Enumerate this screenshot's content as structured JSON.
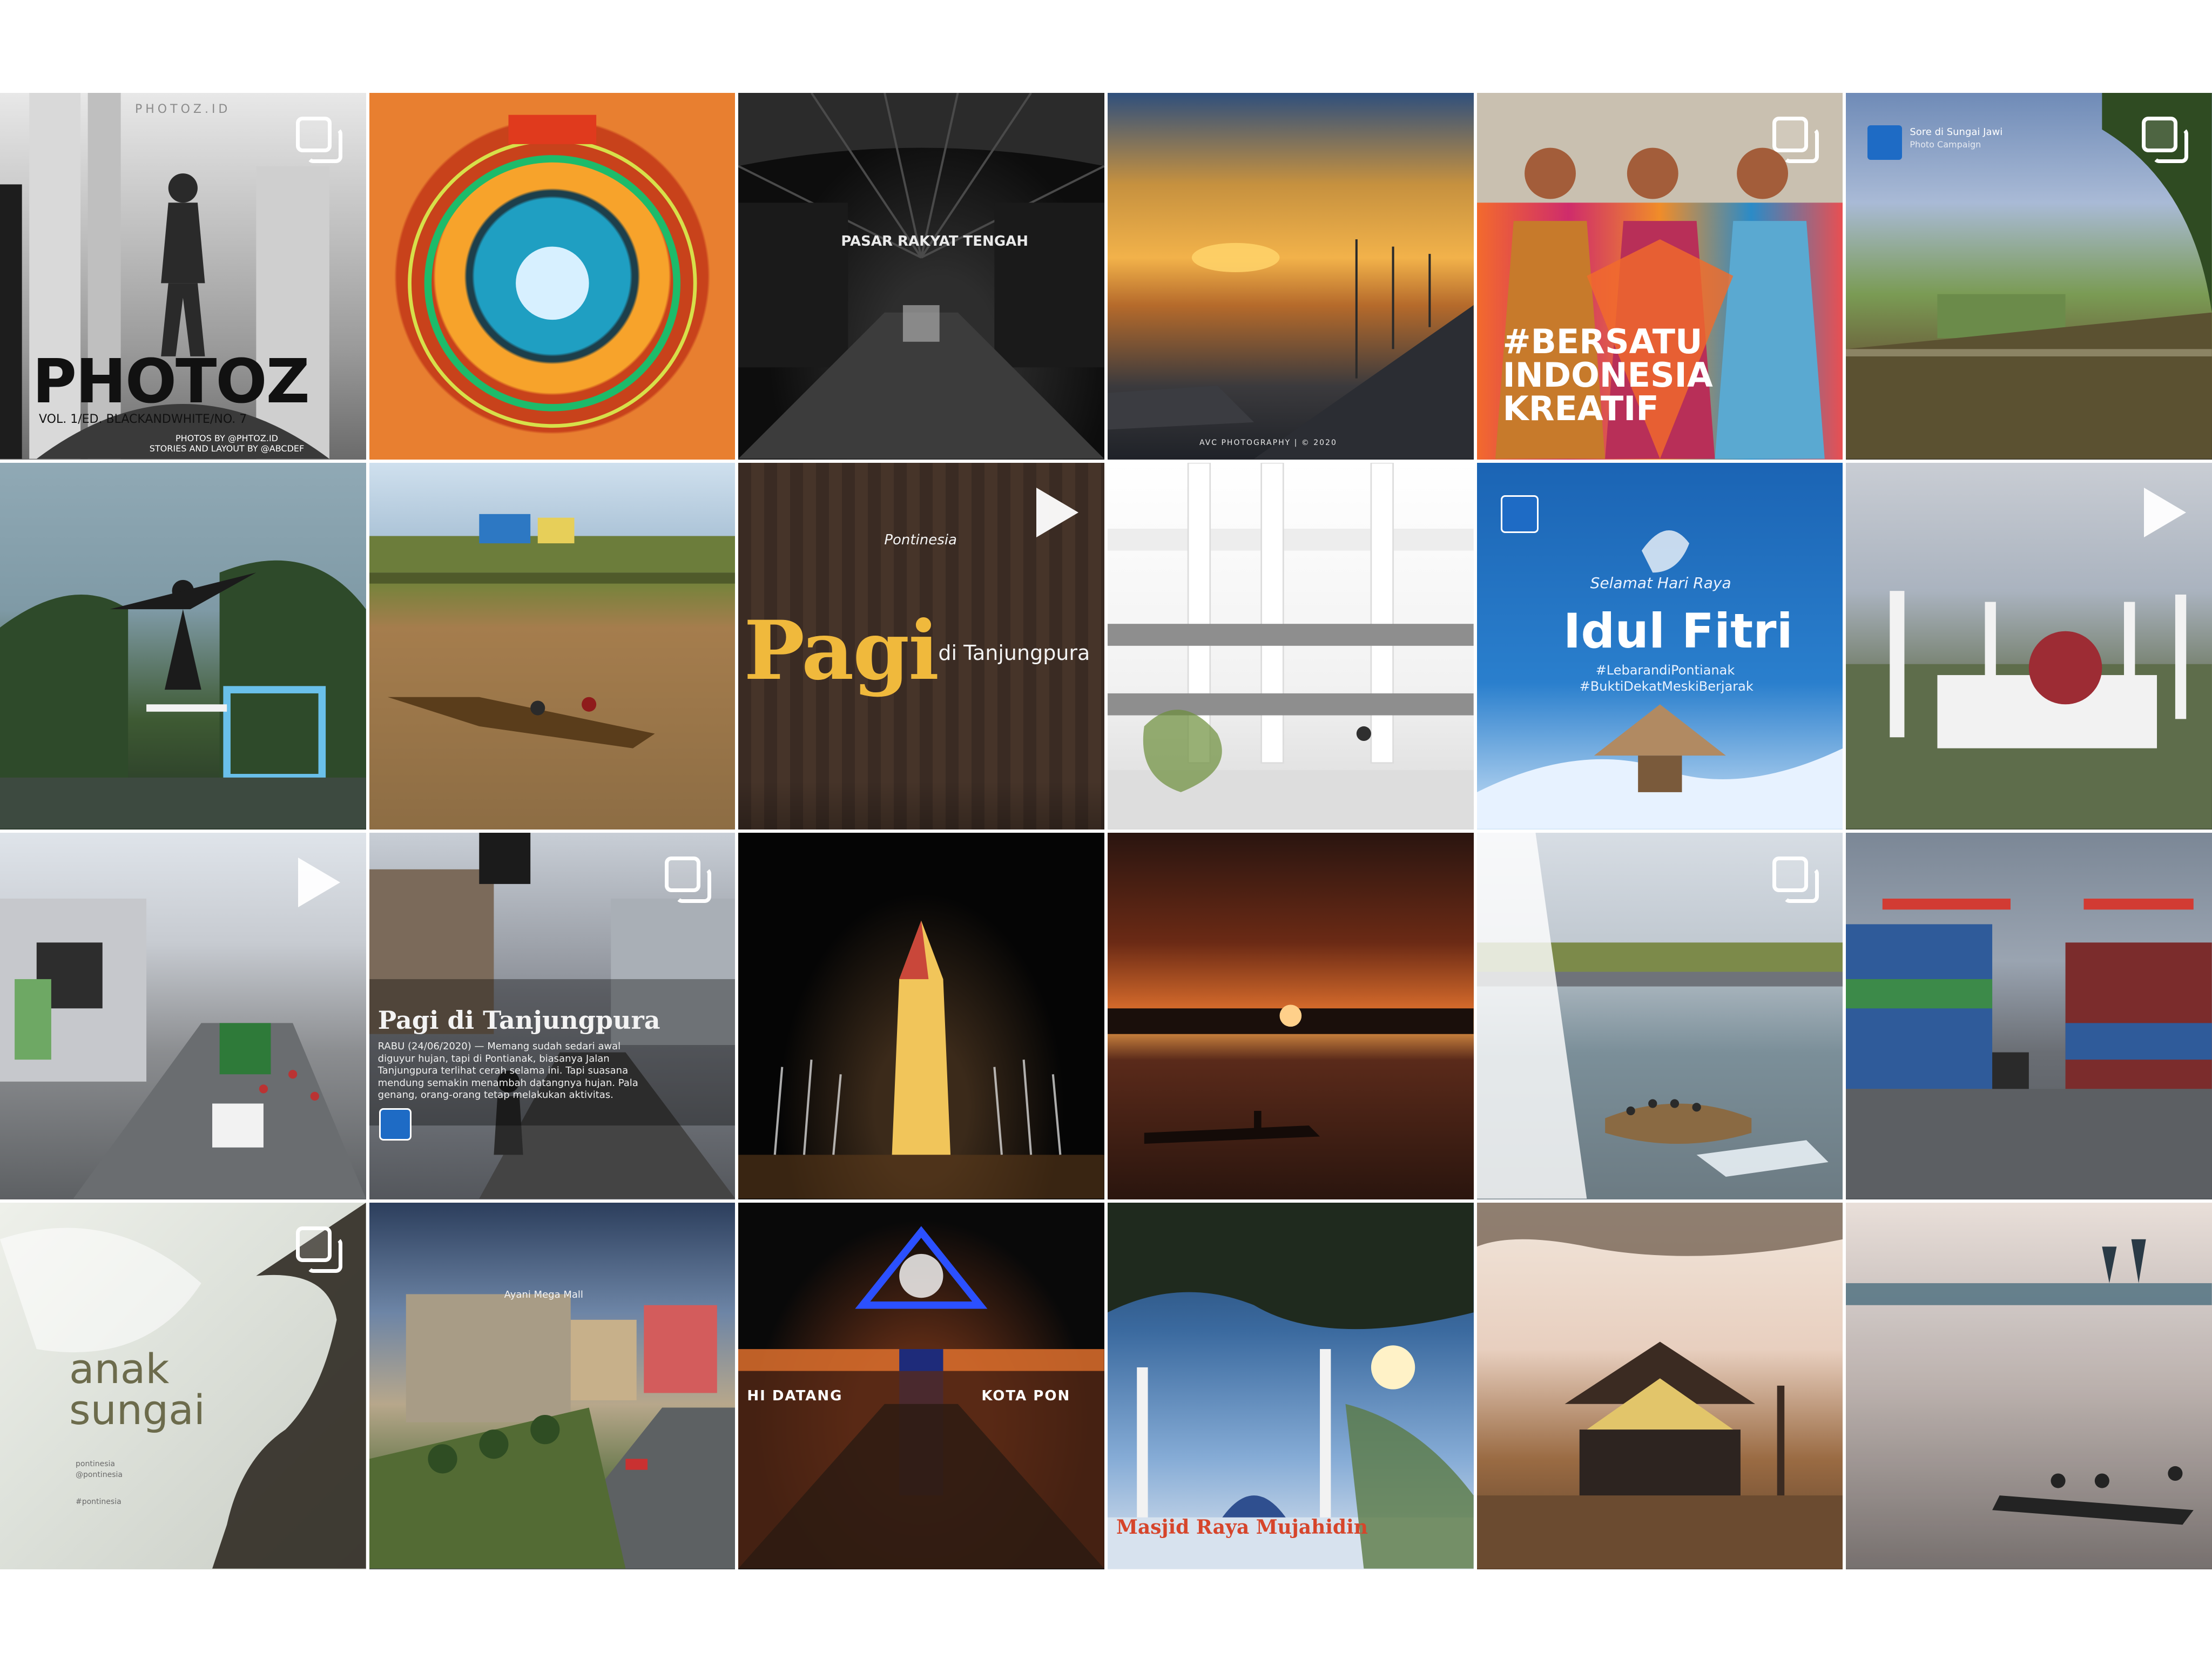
{
  "grid": {
    "tiles": [
      {
        "id": "photoz",
        "badge": "carousel",
        "title": "PHOTOZ",
        "subtitle": "VOL. 1/ED. BLACKANDWHITE/NO. 7",
        "top_small": "PHOTOZ.ID",
        "credits": "PHOTOS BY @PHTOZ.ID\nSTORIES AND LAYOUT BY @ABCDEF"
      },
      {
        "id": "light-trails-circle",
        "badge": "none"
      },
      {
        "id": "market-bw",
        "badge": "none",
        "sign": "PASAR RAKYAT TENGAH"
      },
      {
        "id": "sunset-river-waterfront",
        "badge": "none",
        "footer": "AVC PHOTOGRAPHY | © 2020"
      },
      {
        "id": "bersatu-indonesia",
        "badge": "carousel",
        "lines": [
          "#BERSATU",
          "INDONESIA",
          "KREATIF"
        ]
      },
      {
        "id": "sore-di-sungai-jawi",
        "badge": "carousel",
        "small_title": "Sore di Sungai Jawi",
        "small_sub": "Photo Campaign"
      },
      {
        "id": "skateboarder",
        "badge": "none"
      },
      {
        "id": "river-boat",
        "badge": "none"
      },
      {
        "id": "pagi-tanjungpura",
        "badge": "play",
        "brand": "Pontinesia",
        "big": "Pagi",
        "small": "di Tanjungpura"
      },
      {
        "id": "white-building",
        "badge": "none"
      },
      {
        "id": "idul-fitri",
        "badge": "none",
        "script": "Selamat Hari Raya",
        "title": "Idul Fitri",
        "tags": [
          "#LebarandiPontianak",
          "#BuktiDekatMeskiBerjarak"
        ]
      },
      {
        "id": "mosque-aerial",
        "badge": "play"
      },
      {
        "id": "street-traffic",
        "badge": "play"
      },
      {
        "id": "pagi-di-tanjungpura-article",
        "badge": "carousel",
        "title": "Pagi di Tanjungpura",
        "body": "RABU (24/06/2020) — Memang sudah sedari awal diguyur hujan, tapi di Pontianak, biasanya Jalan Tanjungpura terlihat cerah selama ini. Tapi suasana mendung semakin menambah datangnya hujan. Pala genang, orang-orang tetap melakukan aktivitas."
      },
      {
        "id": "night-fountain-monument",
        "badge": "none"
      },
      {
        "id": "sunset-canoe",
        "badge": "none"
      },
      {
        "id": "river-cafe",
        "badge": "carousel"
      },
      {
        "id": "port-containers",
        "badge": "none"
      },
      {
        "id": "anak-sungai",
        "badge": "carousel",
        "title_top": "anak",
        "title_bottom": "sungai",
        "meta1": "pontinesia",
        "meta2": "@pontinesia",
        "meta3": "#pontinesia"
      },
      {
        "id": "mall-avenue",
        "badge": "none",
        "sign": "Ayani Mega Mall"
      },
      {
        "id": "night-gate",
        "badge": "none",
        "banner_left": "HI DATANG",
        "banner_right": "KOTA PON"
      },
      {
        "id": "mosque-tree",
        "badge": "none",
        "sign": "Masjid Raya Mujahidin"
      },
      {
        "id": "traditional-mosque-river",
        "badge": "none"
      },
      {
        "id": "river-kids-canoe",
        "badge": "none"
      }
    ]
  }
}
